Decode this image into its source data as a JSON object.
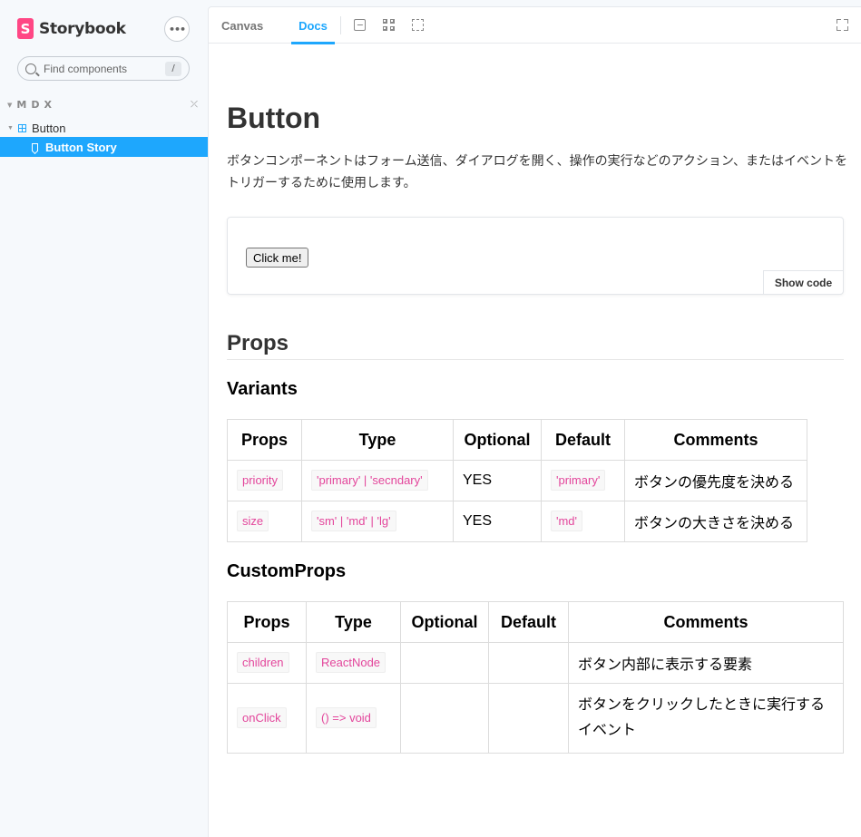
{
  "sidebar": {
    "brand": "Storybook",
    "brand_logo": "S",
    "menu_label": "•••",
    "search": {
      "placeholder": "Find components",
      "shortcut": "/"
    },
    "group": {
      "label": "MDX"
    },
    "component": {
      "label": "Button"
    },
    "story": {
      "label": "Button Story",
      "selected": true
    }
  },
  "toolbar": {
    "tabs": [
      {
        "label": "Canvas",
        "active": false
      },
      {
        "label": "Docs",
        "active": true
      }
    ],
    "icons": [
      "image-icon",
      "grid-icon",
      "outline-icon",
      "fullscreen-icon"
    ]
  },
  "docs": {
    "title": "Button",
    "description": "ボタンコンポーネントはフォーム送信、ダイアログを開く、操作の実行などのアクション、またはイベントをトリガーするために使用します。",
    "preview": {
      "button_label": "Click me!",
      "show_code_label": "Show code"
    },
    "props_heading": "Props",
    "variants": {
      "heading": "Variants",
      "headers": [
        "Props",
        "Type",
        "Optional",
        "Default",
        "Comments"
      ],
      "rows": [
        {
          "prop": "priority",
          "type": "'primary' | 'secndary'",
          "optional": "YES",
          "default": "'primary'",
          "comment": "ボタンの優先度を決める"
        },
        {
          "prop": "size",
          "type": "'sm' | 'md' | 'lg'",
          "optional": "YES",
          "default": "'md'",
          "comment": "ボタンの大きさを決める"
        }
      ]
    },
    "custom_props": {
      "heading": "CustomProps",
      "headers": [
        "Props",
        "Type",
        "Optional",
        "Default",
        "Comments"
      ],
      "rows": [
        {
          "prop": "children",
          "type": "ReactNode",
          "optional": "",
          "default": "",
          "comment": "ボタン内部に表示する要素"
        },
        {
          "prop": "onClick",
          "type": "() => void",
          "optional": "",
          "default": "",
          "comment": "ボタンをクリックしたときに実行するイベント"
        }
      ]
    }
  },
  "colors": {
    "accent": "#1ea7fd",
    "brand": "#ff4785",
    "code_text": "#e3459b"
  }
}
